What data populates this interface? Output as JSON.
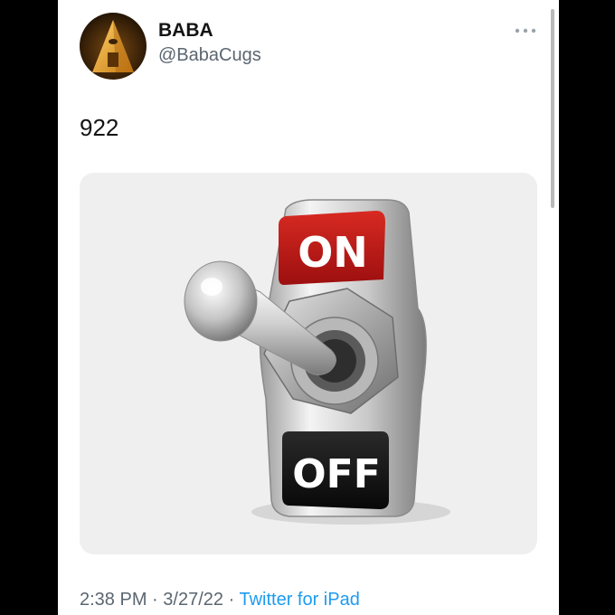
{
  "tweet": {
    "author": {
      "name": "BABA",
      "handle": "@BabaCugs"
    },
    "text": "922",
    "media": {
      "switch_on_label": "ON",
      "switch_off_label": "OFF",
      "switch_state": "on"
    },
    "time": "2:38 PM",
    "separator": "·",
    "date": "3/27/22",
    "source": "Twitter for iPad"
  },
  "icons": {
    "more": "more-horizontal-icon",
    "avatar": "pyramid-avatar-icon"
  },
  "colors": {
    "link": "#1d9bf0",
    "secondary_text": "#5b6670",
    "on_label": "#c41a1a",
    "off_label": "#111111"
  }
}
